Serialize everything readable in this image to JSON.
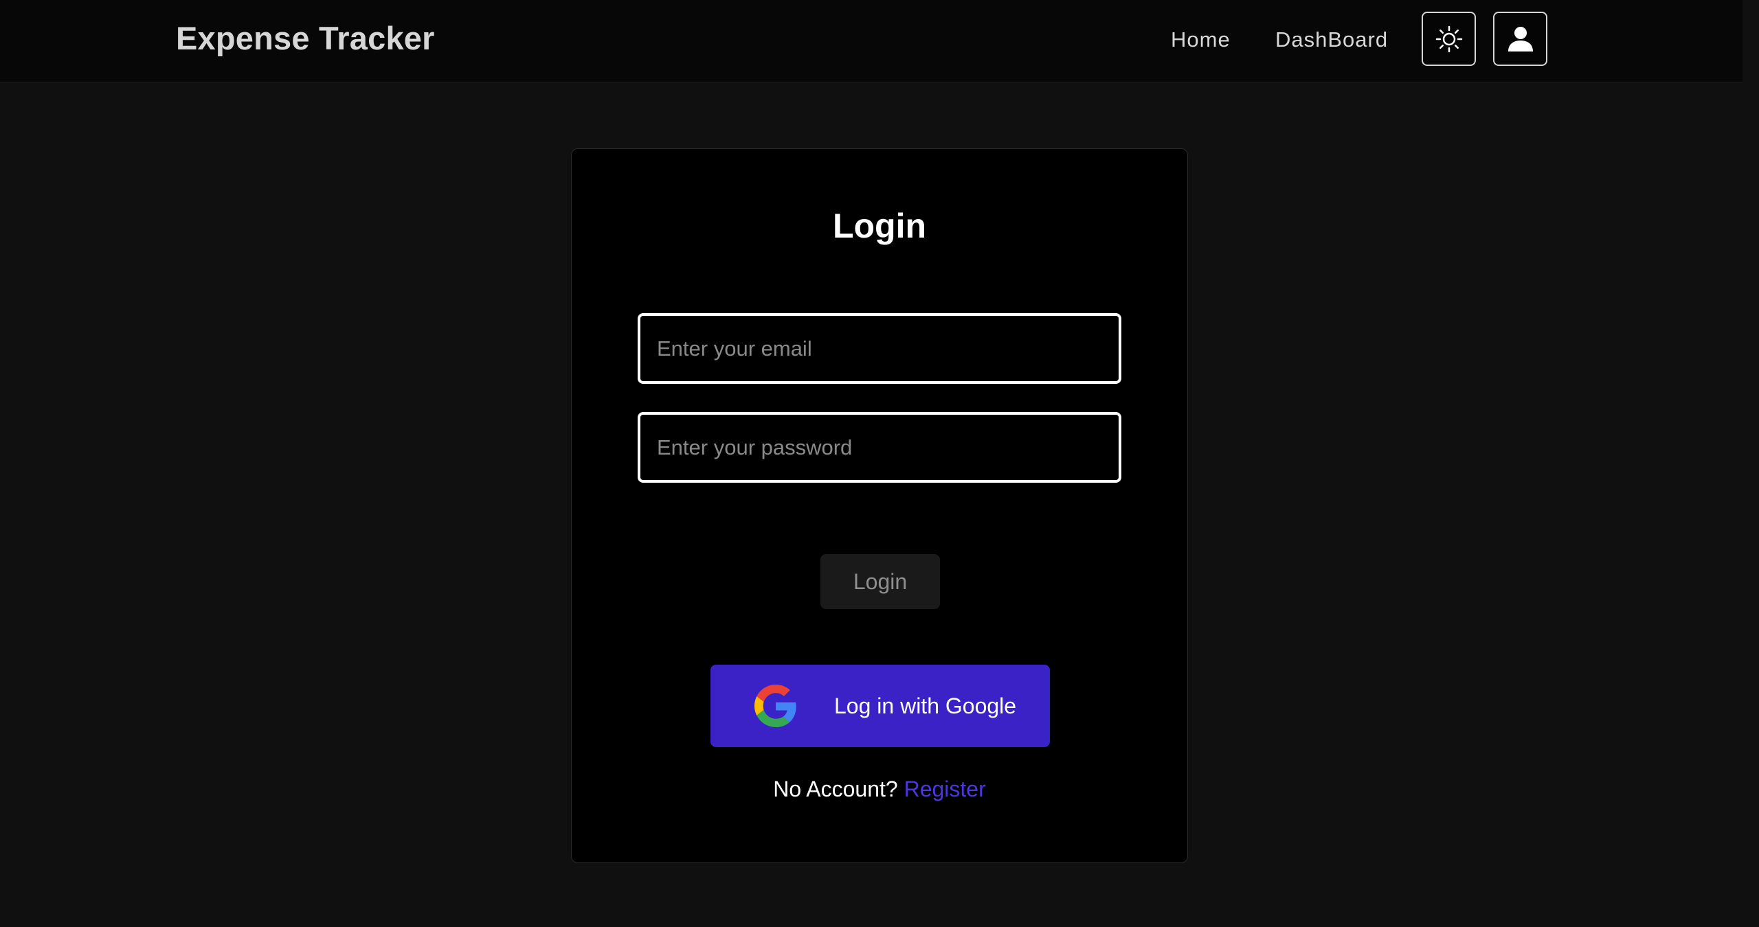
{
  "header": {
    "brand": "Expense Tracker",
    "nav": [
      {
        "label": "Home"
      },
      {
        "label": "DashBoard"
      }
    ],
    "icons": {
      "theme_toggle": "sun-icon",
      "account": "user-icon"
    }
  },
  "login_card": {
    "title": "Login",
    "email": {
      "value": "",
      "placeholder": "Enter your email"
    },
    "password": {
      "value": "",
      "placeholder": "Enter your password"
    },
    "login_button": "Login",
    "google_button": "Log in with Google",
    "footer_prompt": "No Account?",
    "register_link": "Register"
  },
  "colors": {
    "background": "#101010",
    "header": "#070707",
    "card": "#000000",
    "accent": "#3a22c6",
    "link": "#4b36e0"
  }
}
